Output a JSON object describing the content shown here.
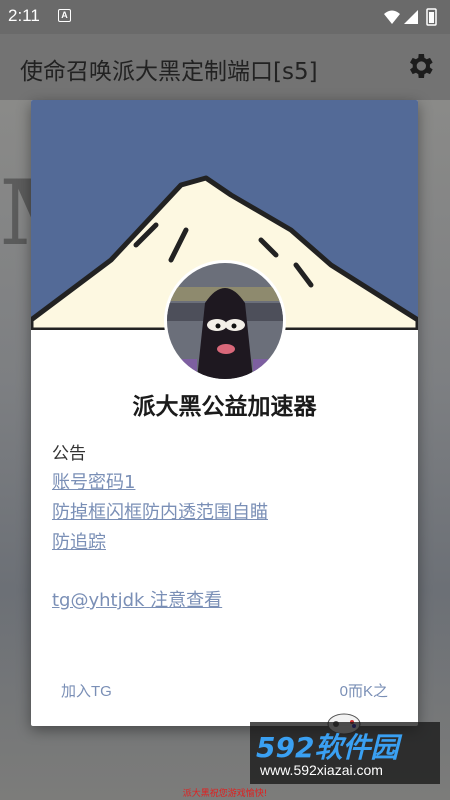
{
  "status_bar": {
    "time": "2:11",
    "notification_letter": "A"
  },
  "app_bar": {
    "title": "使命召唤派大黑定制端口[s5]",
    "settings_icon": "gear-icon"
  },
  "background": {
    "poster_text": "M"
  },
  "dialog": {
    "title": "派大黑公益加速器",
    "notice_heading": "公告",
    "notice_lines": [
      "账号密码1",
      "防掉框闪框防内透范围自瞄",
      "防追踪"
    ],
    "contact": "tg@yhtjdk 注意查看",
    "buttons": {
      "join": "加入TG",
      "ok": "0而K之"
    },
    "colors": {
      "header": "#536a97",
      "link": "#7a8fb6",
      "mountain_snow": "#fdf8e1"
    }
  },
  "watermark": {
    "brand": "592软件园",
    "url": "www.592xiazai.com"
  },
  "footer_note": "派大黑祝您游戏愉快!"
}
